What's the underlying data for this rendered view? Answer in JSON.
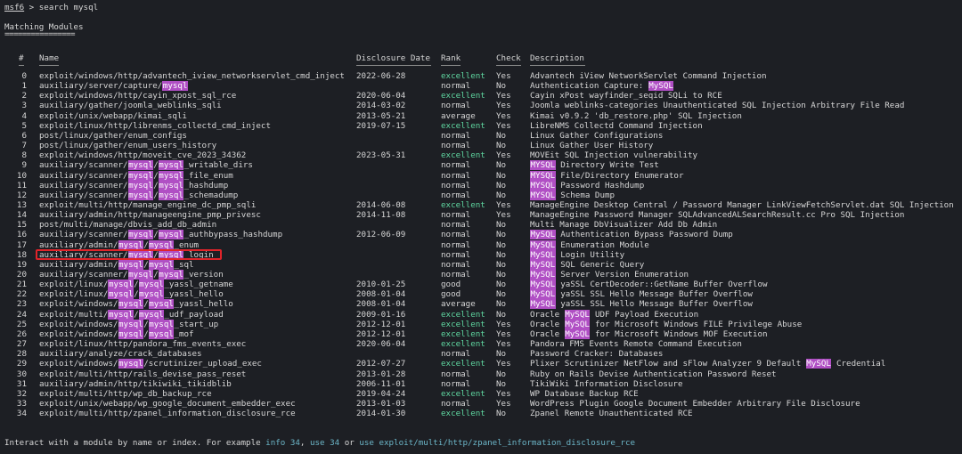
{
  "prompt": {
    "shell": "msf6",
    "separator": " > ",
    "command": "search mysql"
  },
  "section_title": "Matching Modules",
  "underline": "================",
  "columns": {
    "idx": "#",
    "name": "Name",
    "date": "Disclosure Date",
    "rank": "Rank",
    "check": "Check",
    "desc": "Description"
  },
  "highlight_term": "mysql",
  "highlight_term_desc": "MySQL",
  "rows": [
    {
      "idx": "0",
      "name": "exploit/windows/http/advantech_iview_networkservlet_cmd_inject",
      "date": "2022-06-28",
      "rank": "excellent",
      "check": "Yes",
      "desc": "Advantech iView NetworkServlet Command Injection"
    },
    {
      "idx": "1",
      "name": "auxiliary/server/capture/mysql",
      "date": "",
      "rank": "normal",
      "check": "No",
      "desc": "Authentication Capture: MySQL"
    },
    {
      "idx": "2",
      "name": "exploit/windows/http/cayin_xpost_sql_rce",
      "date": "2020-06-04",
      "rank": "excellent",
      "check": "Yes",
      "desc": "Cayin xPost wayfinder_seqid SQLi to RCE"
    },
    {
      "idx": "3",
      "name": "auxiliary/gather/joomla_weblinks_sqli",
      "date": "2014-03-02",
      "rank": "normal",
      "check": "Yes",
      "desc": "Joomla weblinks-categories Unauthenticated SQL Injection Arbitrary File Read"
    },
    {
      "idx": "4",
      "name": "exploit/unix/webapp/kimai_sqli",
      "date": "2013-05-21",
      "rank": "average",
      "check": "Yes",
      "desc": "Kimai v0.9.2 'db_restore.php' SQL Injection"
    },
    {
      "idx": "5",
      "name": "exploit/linux/http/librenms_collectd_cmd_inject",
      "date": "2019-07-15",
      "rank": "excellent",
      "check": "Yes",
      "desc": "LibreNMS Collectd Command Injection"
    },
    {
      "idx": "6",
      "name": "post/linux/gather/enum_configs",
      "date": "",
      "rank": "normal",
      "check": "No",
      "desc": "Linux Gather Configurations"
    },
    {
      "idx": "7",
      "name": "post/linux/gather/enum_users_history",
      "date": "",
      "rank": "normal",
      "check": "No",
      "desc": "Linux Gather User History"
    },
    {
      "idx": "8",
      "name": "exploit/windows/http/moveit_cve_2023_34362",
      "date": "2023-05-31",
      "rank": "excellent",
      "check": "Yes",
      "desc": "MOVEit SQL Injection vulnerability"
    },
    {
      "idx": "9",
      "name": "auxiliary/scanner/mysql/mysql_writable_dirs",
      "date": "",
      "rank": "normal",
      "check": "No",
      "desc": "MYSQL Directory Write Test"
    },
    {
      "idx": "10",
      "name": "auxiliary/scanner/mysql/mysql_file_enum",
      "date": "",
      "rank": "normal",
      "check": "No",
      "desc": "MYSQL File/Directory Enumerator"
    },
    {
      "idx": "11",
      "name": "auxiliary/scanner/mysql/mysql_hashdump",
      "date": "",
      "rank": "normal",
      "check": "No",
      "desc": "MYSQL Password Hashdump"
    },
    {
      "idx": "12",
      "name": "auxiliary/scanner/mysql/mysql_schemadump",
      "date": "",
      "rank": "normal",
      "check": "No",
      "desc": "MYSQL Schema Dump"
    },
    {
      "idx": "13",
      "name": "exploit/multi/http/manage_engine_dc_pmp_sqli",
      "date": "2014-06-08",
      "rank": "excellent",
      "check": "Yes",
      "desc": "ManageEngine Desktop Central / Password Manager LinkViewFetchServlet.dat SQL Injection"
    },
    {
      "idx": "14",
      "name": "auxiliary/admin/http/manageengine_pmp_privesc",
      "date": "2014-11-08",
      "rank": "normal",
      "check": "Yes",
      "desc": "ManageEngine Password Manager SQLAdvancedALSearchResult.cc Pro SQL Injection"
    },
    {
      "idx": "15",
      "name": "post/multi/manage/dbvis_add_db_admin",
      "date": "",
      "rank": "normal",
      "check": "No",
      "desc": "Multi Manage DbVisualizer Add Db Admin"
    },
    {
      "idx": "16",
      "name": "auxiliary/scanner/mysql/mysql_authbypass_hashdump",
      "date": "2012-06-09",
      "rank": "normal",
      "check": "No",
      "desc": "MySQL Authentication Bypass Password Dump"
    },
    {
      "idx": "17",
      "name": "auxiliary/admin/mysql/mysql_enum",
      "date": "",
      "rank": "normal",
      "check": "No",
      "desc": "MySQL Enumeration Module"
    },
    {
      "idx": "18",
      "name": "auxiliary/scanner/mysql/mysql_login",
      "date": "",
      "rank": "normal",
      "check": "No",
      "desc": "MySQL Login Utility"
    },
    {
      "idx": "19",
      "name": "auxiliary/admin/mysql/mysql_sql",
      "date": "",
      "rank": "normal",
      "check": "No",
      "desc": "MySQL SQL Generic Query"
    },
    {
      "idx": "20",
      "name": "auxiliary/scanner/mysql/mysql_version",
      "date": "",
      "rank": "normal",
      "check": "No",
      "desc": "MySQL Server Version Enumeration"
    },
    {
      "idx": "21",
      "name": "exploit/linux/mysql/mysql_yassl_getname",
      "date": "2010-01-25",
      "rank": "good",
      "check": "No",
      "desc": "MySQL yaSSL CertDecoder::GetName Buffer Overflow"
    },
    {
      "idx": "22",
      "name": "exploit/linux/mysql/mysql_yassl_hello",
      "date": "2008-01-04",
      "rank": "good",
      "check": "No",
      "desc": "MySQL yaSSL SSL Hello Message Buffer Overflow"
    },
    {
      "idx": "23",
      "name": "exploit/windows/mysql/mysql_yassl_hello",
      "date": "2008-01-04",
      "rank": "average",
      "check": "No",
      "desc": "MySQL yaSSL SSL Hello Message Buffer Overflow"
    },
    {
      "idx": "24",
      "name": "exploit/multi/mysql/mysql_udf_payload",
      "date": "2009-01-16",
      "rank": "excellent",
      "check": "No",
      "desc": "Oracle MySQL UDF Payload Execution"
    },
    {
      "idx": "25",
      "name": "exploit/windows/mysql/mysql_start_up",
      "date": "2012-12-01",
      "rank": "excellent",
      "check": "Yes",
      "desc": "Oracle MySQL for Microsoft Windows FILE Privilege Abuse"
    },
    {
      "idx": "26",
      "name": "exploit/windows/mysql/mysql_mof",
      "date": "2012-12-01",
      "rank": "excellent",
      "check": "Yes",
      "desc": "Oracle MySQL for Microsoft Windows MOF Execution"
    },
    {
      "idx": "27",
      "name": "exploit/linux/http/pandora_fms_events_exec",
      "date": "2020-06-04",
      "rank": "excellent",
      "check": "Yes",
      "desc": "Pandora FMS Events Remote Command Execution"
    },
    {
      "idx": "28",
      "name": "auxiliary/analyze/crack_databases",
      "date": "",
      "rank": "normal",
      "check": "No",
      "desc": "Password Cracker: Databases"
    },
    {
      "idx": "29",
      "name": "exploit/windows/mysql/scrutinizer_upload_exec",
      "date": "2012-07-27",
      "rank": "excellent",
      "check": "Yes",
      "desc": "Plixer Scrutinizer NetFlow and sFlow Analyzer 9 Default MySQL Credential"
    },
    {
      "idx": "30",
      "name": "exploit/multi/http/rails_devise_pass_reset",
      "date": "2013-01-28",
      "rank": "normal",
      "check": "No",
      "desc": "Ruby on Rails Devise Authentication Password Reset"
    },
    {
      "idx": "31",
      "name": "auxiliary/admin/http/tikiwiki_tikidblib",
      "date": "2006-11-01",
      "rank": "normal",
      "check": "No",
      "desc": "TikiWiki Information Disclosure"
    },
    {
      "idx": "32",
      "name": "exploit/multi/http/wp_db_backup_rce",
      "date": "2019-04-24",
      "rank": "excellent",
      "check": "Yes",
      "desc": "WP Database Backup RCE"
    },
    {
      "idx": "33",
      "name": "exploit/unix/webapp/wp_google_document_embedder_exec",
      "date": "2013-01-03",
      "rank": "normal",
      "check": "Yes",
      "desc": "WordPress Plugin Google Document Embedder Arbitrary File Disclosure"
    },
    {
      "idx": "34",
      "name": "exploit/multi/http/zpanel_information_disclosure_rce",
      "date": "2014-01-30",
      "rank": "excellent",
      "check": "No",
      "desc": "Zpanel Remote Unauthenticated RCE"
    }
  ],
  "footer": {
    "prefix": "Interact with a module by name or index. For example ",
    "ex1": "info 34",
    "sep1": ", ",
    "ex2": "use 34",
    "sep2": " or ",
    "ex3": "use exploit/multi/http/zpanel_information_disclosure_rce"
  },
  "colors": {
    "background": "#1d1f24",
    "text": "#d6d6d6",
    "excellent": "#5fd7a0",
    "highlight": "#b04fc4",
    "selection_box": "#e0242a",
    "footer_cmd": "#6cb6c8"
  }
}
